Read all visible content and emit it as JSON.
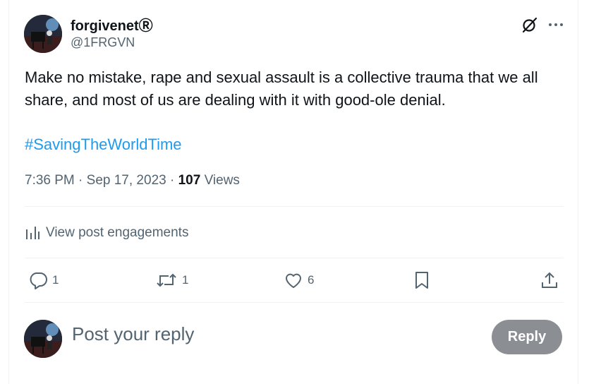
{
  "author": {
    "display_name": "forgivenetⓇ",
    "handle": "@1FRGVN",
    "avatar_icon": "avatar-icon"
  },
  "header_icons": [
    "grok-icon",
    "more-icon"
  ],
  "post": {
    "text": "Make no mistake, rape and sexual assault is a collective trauma that we all share, and most of us are dealing with it with good-ole denial.",
    "hashtag": "#SavingTheWorldTime",
    "time": "7:36 PM",
    "date": "Sep 17, 2023",
    "separator": " · ",
    "views_count": "107",
    "views_label": "Views"
  },
  "engagements_label": "View post engagements",
  "actions": {
    "reply_count": "1",
    "repost_count": "1",
    "like_count": "6"
  },
  "reply_box": {
    "placeholder": "Post your reply",
    "button_label": "Reply"
  },
  "colors": {
    "accent": "#1d9bf0",
    "secondary_text": "#536471",
    "reply_button_disabled": "#8b8f93"
  }
}
